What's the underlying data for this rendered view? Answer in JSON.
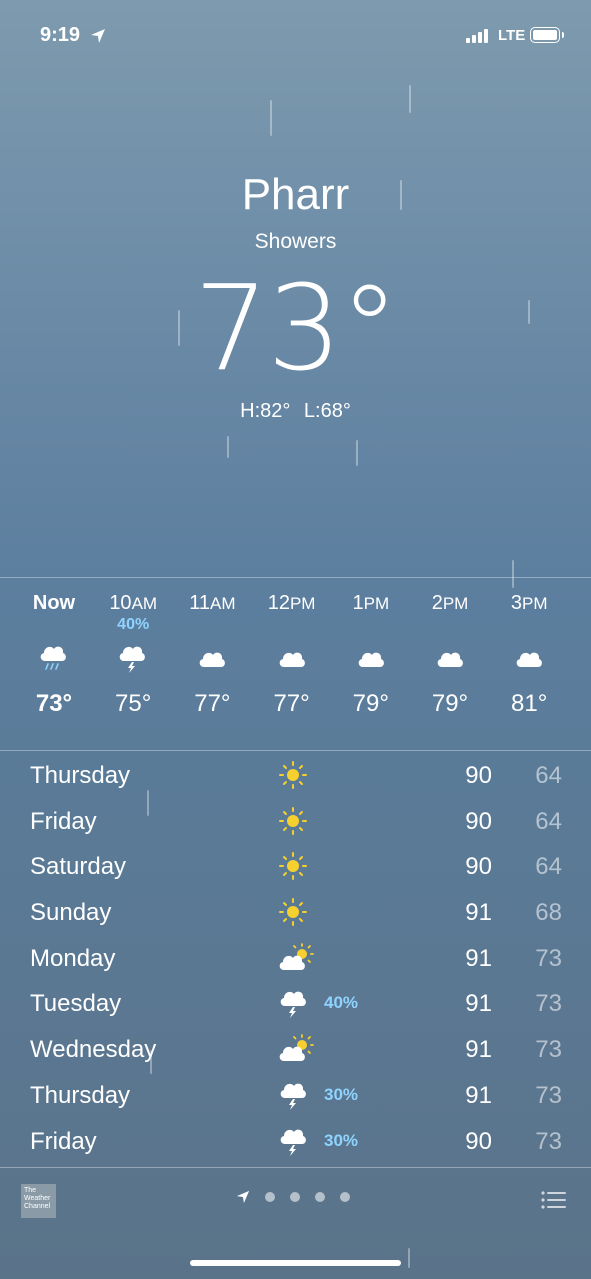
{
  "status": {
    "time": "9:19",
    "network": "LTE"
  },
  "header": {
    "city": "Pharr",
    "condition": "Showers",
    "temperature": "73°",
    "hilo": "H:82° L:68°"
  },
  "hourly": [
    {
      "time": "Now",
      "ampm": "",
      "pop": "",
      "icon": "rain-cloud-icon",
      "temp": "73°"
    },
    {
      "time": "10",
      "ampm": "AM",
      "pop": "40%",
      "icon": "thunderstorm-cloud-icon",
      "temp": "75°"
    },
    {
      "time": "11",
      "ampm": "AM",
      "pop": "",
      "icon": "cloud-icon",
      "temp": "77°"
    },
    {
      "time": "12",
      "ampm": "PM",
      "pop": "",
      "icon": "cloud-icon",
      "temp": "77°"
    },
    {
      "time": "1",
      "ampm": "PM",
      "pop": "",
      "icon": "cloud-icon",
      "temp": "79°"
    },
    {
      "time": "2",
      "ampm": "PM",
      "pop": "",
      "icon": "cloud-icon",
      "temp": "79°"
    },
    {
      "time": "3",
      "ampm": "PM",
      "pop": "",
      "icon": "cloud-icon",
      "temp": "81°"
    }
  ],
  "daily": [
    {
      "day": "Thursday",
      "icon": "sun-icon",
      "pop": "",
      "high": "90",
      "low": "64"
    },
    {
      "day": "Friday",
      "icon": "sun-icon",
      "pop": "",
      "high": "90",
      "low": "64"
    },
    {
      "day": "Saturday",
      "icon": "sun-icon",
      "pop": "",
      "high": "90",
      "low": "64"
    },
    {
      "day": "Sunday",
      "icon": "sun-icon",
      "pop": "",
      "high": "91",
      "low": "68"
    },
    {
      "day": "Monday",
      "icon": "partly-cloudy-icon",
      "pop": "",
      "high": "91",
      "low": "73"
    },
    {
      "day": "Tuesday",
      "icon": "thunderstorm-cloud-icon",
      "pop": "40%",
      "high": "91",
      "low": "73"
    },
    {
      "day": "Wednesday",
      "icon": "partly-cloudy-icon",
      "pop": "",
      "high": "91",
      "low": "73"
    },
    {
      "day": "Thursday",
      "icon": "thunderstorm-cloud-icon",
      "pop": "30%",
      "high": "91",
      "low": "73"
    },
    {
      "day": "Friday",
      "icon": "thunderstorm-cloud-icon",
      "pop": "30%",
      "high": "90",
      "low": "73"
    }
  ],
  "footer": {
    "logo_text": "The Weather Channel",
    "page_count": 4
  },
  "colors": {
    "precip": "#8fd3ff",
    "sun": "#f6d02f"
  }
}
